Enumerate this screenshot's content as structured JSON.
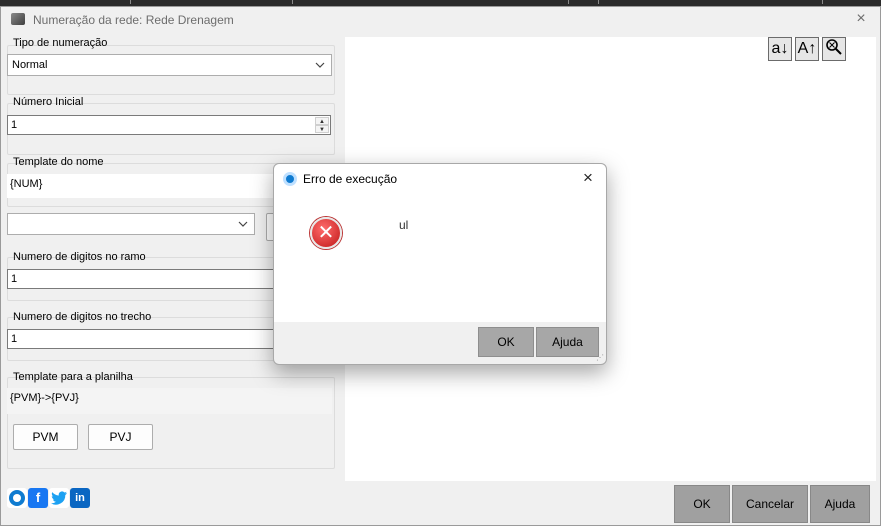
{
  "window": {
    "title": "Numeração da rede: Rede Drenagem",
    "close_glyph": "×"
  },
  "numbering_type": {
    "label": "Tipo de numeração",
    "value": "Normal"
  },
  "initial_number": {
    "label": "Número Inicial",
    "value": "1"
  },
  "name_template": {
    "label": "Template do nome",
    "value": "{NUM}"
  },
  "branch_digits": {
    "label": "Numero de digitos no ramo",
    "value": "1"
  },
  "segment_digits": {
    "label": "Numero de digitos no trecho",
    "value": "1"
  },
  "sheet_template": {
    "label": "Template para a planilha",
    "value": "{PVM}->{PVJ}",
    "buttons": [
      "PVM",
      "PVJ"
    ]
  },
  "toolbar": {
    "sort_asc_label": "a↓",
    "sort_desc_label": "A↑",
    "zoom_icon": "⚲"
  },
  "footer": {
    "ok": "OK",
    "cancel": "Cancelar",
    "help": "Ajuda"
  },
  "social_icons": [
    "app-logo-icon",
    "facebook-icon",
    "twitter-icon",
    "linkedin-icon"
  ],
  "social_glyphs": {
    "facebook": "f",
    "linkedin": "in"
  },
  "error_dialog": {
    "title": "Erro de execução",
    "close_glyph": "×",
    "message": "ul",
    "icon_glyph": "✕",
    "ok": "OK",
    "help": "Ajuda"
  },
  "colors": {
    "footer_button": "#a0a0a0",
    "error_icon": "#d32f2f",
    "facebook": "#1877f2",
    "twitter": "#1da1f2",
    "linkedin": "#0a66c2"
  }
}
